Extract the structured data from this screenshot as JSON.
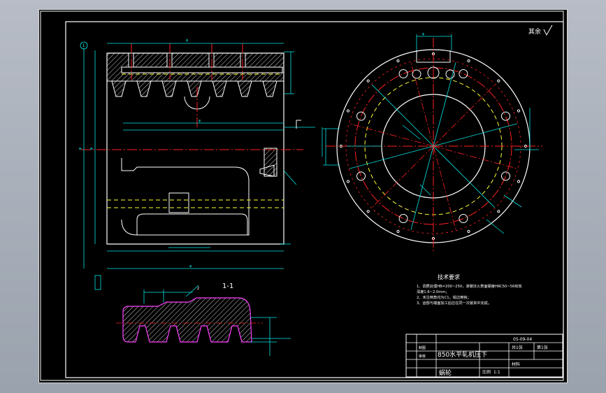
{
  "drawing": {
    "corner_mark": "其余",
    "section_label": "1-1",
    "ref_label_1": "1",
    "tech_requirements": {
      "title": "技术要求",
      "lines": [
        "1、调质处理HB=200~250，渗碳淬火表面硬度HRC50~56有效",
        "   深度1.6~2.0mm；",
        "2、未注倒角均为C1，锐边倒钝；",
        "3、齿部与端面加工后应在同一次装夹中完成。"
      ]
    },
    "title_block": {
      "product_name": "850水平轧机压下",
      "part_name": "蜗轮",
      "date": "05-09-04",
      "scale_label": "比例",
      "scale_value": "1:1",
      "sheet_label": "共1张",
      "sheet_no": "第1张",
      "drawn_label": "制图",
      "checked_label": "审核",
      "material_label": "材料"
    },
    "colors": {
      "background": "#000000",
      "outline": "#ffffff",
      "dimension": "#00e5e5",
      "centerline": "#ff2020",
      "hidden": "#ffff33",
      "hatch": "#ffffff",
      "section_outline": "#ff40ff"
    }
  }
}
